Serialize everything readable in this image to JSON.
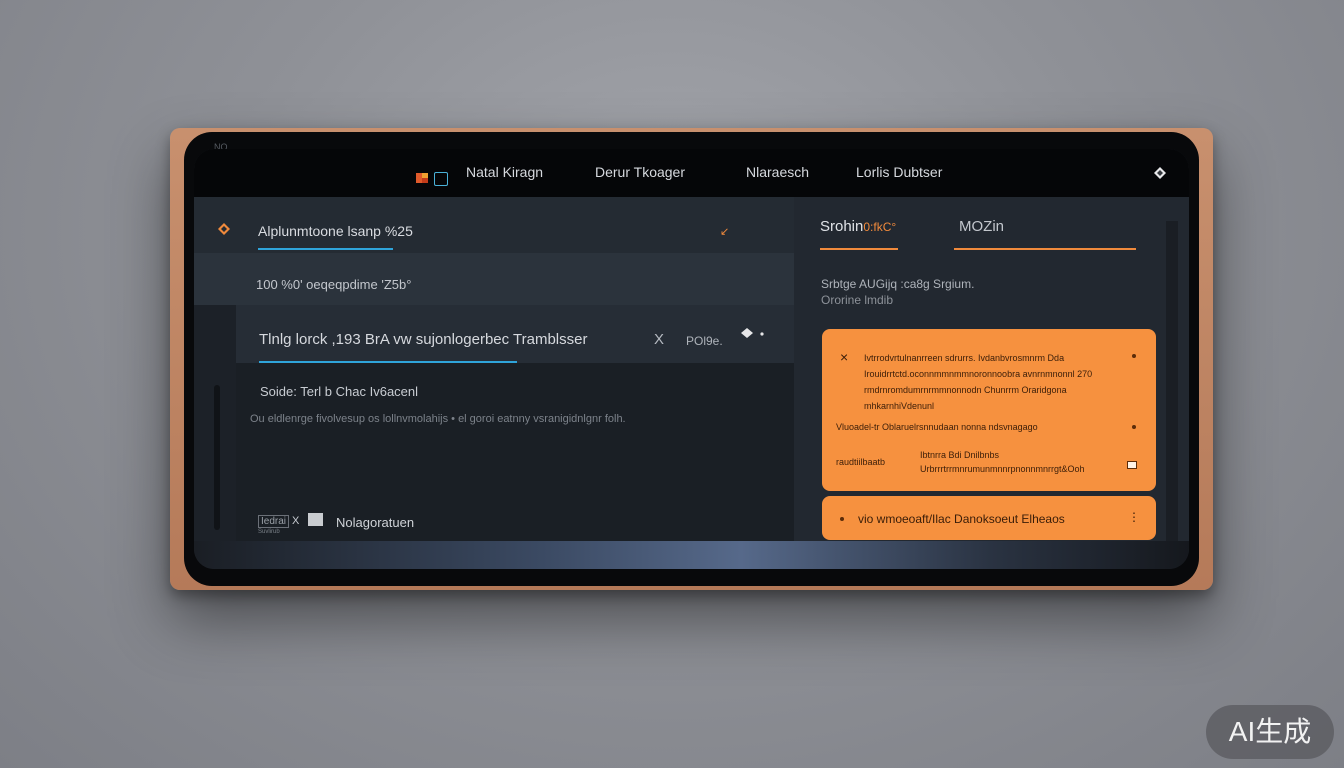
{
  "window": {
    "bezel_label": "NO"
  },
  "topbar": {
    "nav": [
      "Natal Kiragn",
      "Derur Tkoager",
      "Nlaraesch",
      "Lorlis Dubtser"
    ]
  },
  "left_panel": {
    "header_title": "Alplunmtoone lsanp %25",
    "header_arrow": "↙",
    "subrow_text": "100  %0' oeqeqpdime 'Z5b°",
    "input_value": "Tlnlg lorck ,193 BrA vw sujonlogerbec Tramblsser",
    "input_close": "X",
    "input_meta": "POl9e.",
    "label_line": "Soide: Terl b Chac Iv6acenl",
    "hint_line": "Ou eldlenrge fivolvesup os lollnvmolahijs  • el goroi  eatnny vsranigidnlgnr folh.",
    "footer_tag": "Iedrai",
    "footer_sub": "Suvlirub",
    "footer_x": "X",
    "footer_label": "Nolagoratuen"
  },
  "right_panel": {
    "tabs": [
      {
        "label_main": "Srohin",
        "label_accent": "0:fkC°"
      },
      {
        "label_main": "MOZin",
        "label_accent": ""
      }
    ],
    "summary_line1": "Srbtge AUGijq   :ca8g Srgium.",
    "summary_line2": "Ororine lmdib",
    "card": {
      "close": "×",
      "lines": [
        "Ivtrrodvrtulnanrreen sdrurrs. Ivdanbvrosmnrm Dda",
        "Irouidrrtctd.oconnmmnmmnoronnoobra avnrnmnonnl 270",
        "rmdrnromdumrnrmmnonnodn Chunrrm Oraridgona",
        "mhkarnhiVdenunl",
        "Vluoadel-tr   Oblaruelrsnnudaan nonna ndsvnagago",
        "raudtiilbaatb",
        "Ibtnrra Bdi Dnilbnbs",
        "Urbrrrtrrmnrumunmnnrpnonnmnrrgt&Ooh"
      ]
    },
    "card2": {
      "text": "vio wmoeoaft/Ilac Danoksoeut Elheaos",
      "more": "⋮"
    }
  },
  "watermark": {
    "text": "AI生成"
  },
  "colors": {
    "accent_orange": "#f6913f",
    "accent_blue": "#2fa4da",
    "panel_dark": "#1f242b"
  }
}
